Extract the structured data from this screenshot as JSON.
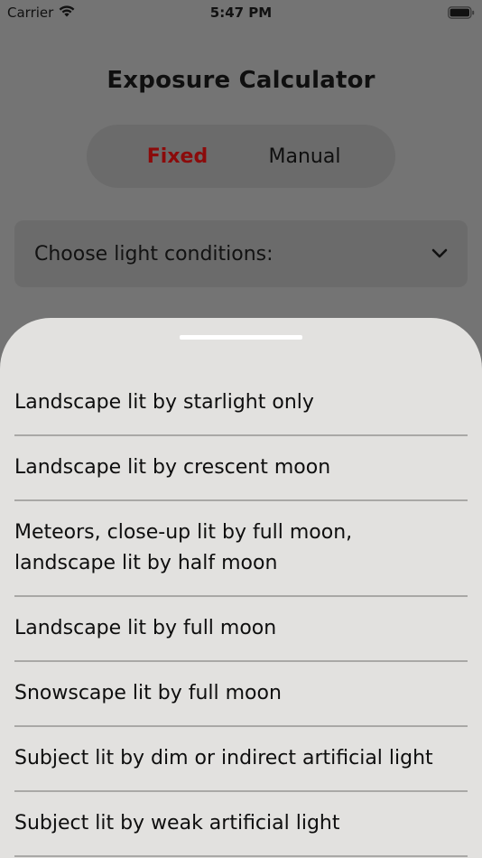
{
  "status_bar": {
    "carrier": "Carrier",
    "time": "5:47 PM",
    "icons": [
      "wifi-icon",
      "battery-icon"
    ]
  },
  "header": {
    "title": "Exposure Calculator"
  },
  "mode_toggle": {
    "options": [
      "Fixed",
      "Manual"
    ],
    "selected": "Fixed",
    "selected_color": "#8b0b0b"
  },
  "conditions_dropdown": {
    "placeholder": "Choose light conditions:",
    "icon": "chevron-down-icon"
  },
  "sheet": {
    "options": [
      "Landscape lit by starlight only",
      "Landscape lit by crescent moon",
      "Meteors, close-up lit by full moon,\nlandscape lit by half moon",
      "Landscape lit by full moon",
      "Snowscape lit by full moon",
      "Subject lit by dim or indirect artificial light",
      "Subject lit by weak artificial light"
    ]
  },
  "colors": {
    "dim_background": "#747474",
    "sheet_background": "#e2e1df",
    "accent": "#8b0b0b"
  }
}
